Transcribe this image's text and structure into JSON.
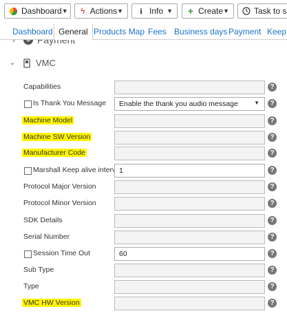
{
  "toolbar": {
    "dashboard": "Dashboard",
    "actions": "Actions",
    "info": "Info",
    "create": "Create",
    "task": "Task to sche"
  },
  "tabs": [
    "Dashboard",
    "General",
    "Products Map",
    "Fees",
    "Business days",
    "Payment",
    "Keep A"
  ],
  "sections": {
    "payment": "Payment",
    "vmc": "VMC"
  },
  "form": {
    "capabilities": {
      "label": "Capabilities",
      "value": ""
    },
    "thank_you": {
      "label": "Is Thank You Message",
      "value": "Enable the thank you audio message"
    },
    "machine_model": {
      "label": "Machine Model",
      "value": ""
    },
    "machine_sw": {
      "label": "Machine SW Version",
      "value": ""
    },
    "manufacturer_code": {
      "label": "Manufacturer Code",
      "value": ""
    },
    "marshall": {
      "label": "Marshall Keep alive intervals",
      "value": "1"
    },
    "protocol_major": {
      "label": "Protocol Major Version",
      "value": ""
    },
    "protocol_minor": {
      "label": "Protocol Minor Version",
      "value": ""
    },
    "sdk_details": {
      "label": "SDK Details",
      "value": ""
    },
    "serial_number": {
      "label": "Serial Number",
      "value": ""
    },
    "session_timeout": {
      "label": "Session Time Out",
      "value": "60"
    },
    "sub_type": {
      "label": "Sub Type",
      "value": ""
    },
    "type": {
      "label": "Type",
      "value": ""
    },
    "vmc_hw": {
      "label": "VMC HW Version",
      "value": ""
    }
  },
  "help_glyph": "?",
  "colors": {
    "highlight": "#fff500",
    "tab_link": "#1a73c8"
  }
}
